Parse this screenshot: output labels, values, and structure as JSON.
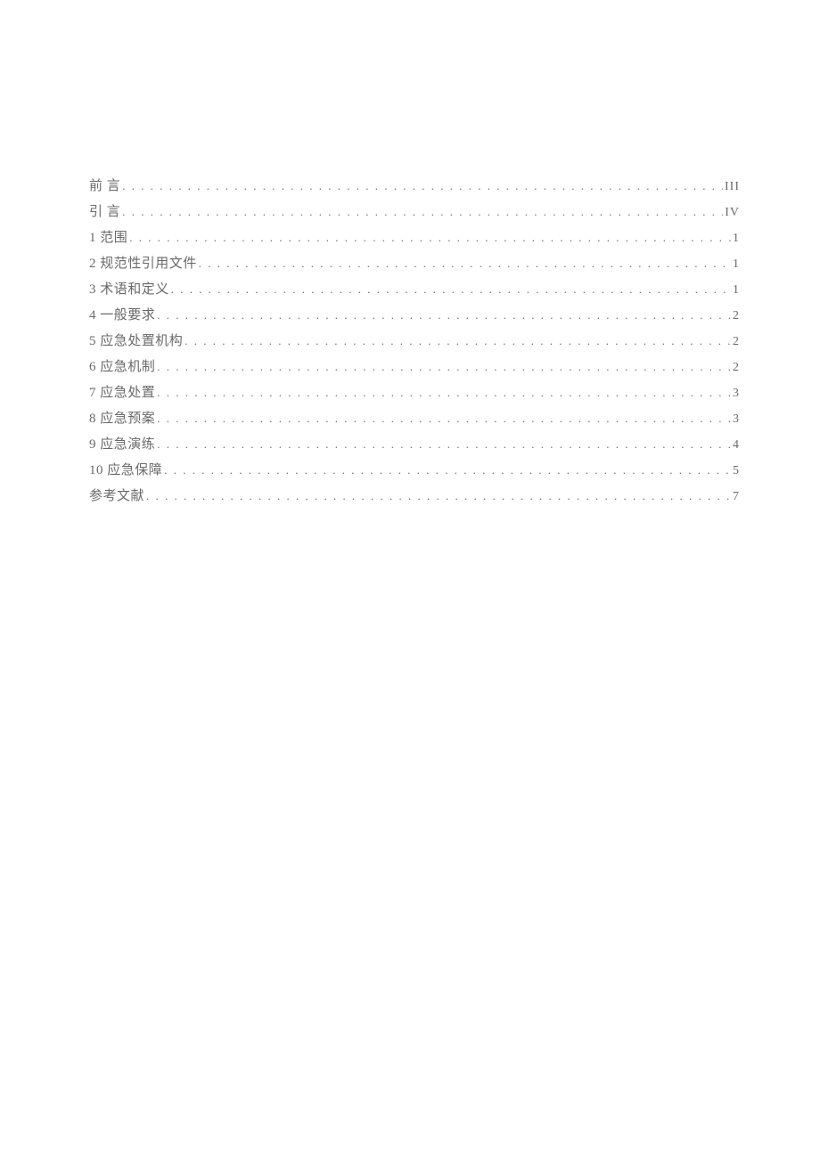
{
  "toc": [
    {
      "title": "前 言",
      "page": "III",
      "spaced": true
    },
    {
      "title": "引 言",
      "page": "IV",
      "spaced": true
    },
    {
      "title": "1 范围",
      "page": "1",
      "spaced": false
    },
    {
      "title": "2 规范性引用文件",
      "page": "1",
      "spaced": false
    },
    {
      "title": "3 术语和定义",
      "page": "1",
      "spaced": false
    },
    {
      "title": "4 一般要求",
      "page": "2",
      "spaced": false
    },
    {
      "title": "5 应急处置机构",
      "page": "2",
      "spaced": false
    },
    {
      "title": "6 应急机制",
      "page": "2",
      "spaced": false
    },
    {
      "title": "7 应急处置",
      "page": "3",
      "spaced": false
    },
    {
      "title": "8 应急预案",
      "page": "3",
      "spaced": false
    },
    {
      "title": "9 应急演练",
      "page": "4",
      "spaced": false
    },
    {
      "title": "10 应急保障",
      "page": "5",
      "spaced": false
    },
    {
      "title": "参考文献",
      "page": "7",
      "spaced": false
    }
  ]
}
